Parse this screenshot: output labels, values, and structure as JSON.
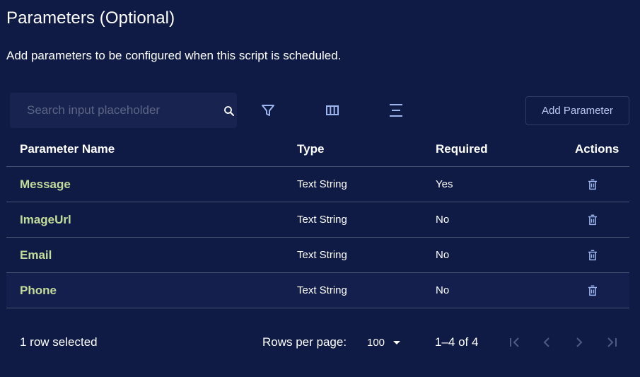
{
  "header": {
    "title": "Parameters (Optional)",
    "subtitle": "Add parameters to be configured when this script is scheduled."
  },
  "toolbar": {
    "search_placeholder": "Search input placeholder",
    "add_button_label": "Add Parameter",
    "icons": [
      "search-icon",
      "filter-icon",
      "columns-icon",
      "density-icon"
    ]
  },
  "table": {
    "columns": [
      "Parameter Name",
      "Type",
      "Required",
      "Actions"
    ],
    "rows": [
      {
        "name": "Message",
        "type": "Text String",
        "required": "Yes"
      },
      {
        "name": "ImageUrl",
        "type": "Text String",
        "required": "No"
      },
      {
        "name": "Email",
        "type": "Text String",
        "required": "No"
      },
      {
        "name": "Phone",
        "type": "Text String",
        "required": "No"
      }
    ]
  },
  "footer": {
    "selected_text": "1 row selected",
    "rows_per_page_label": "Rows per page:",
    "rows_per_page_value": "100",
    "range_text": "1–4 of 4"
  },
  "colors": {
    "background": "#0f1b45",
    "name_text": "#c3dc9a",
    "icon": "#9db5ee",
    "divider": "#4a5274"
  }
}
